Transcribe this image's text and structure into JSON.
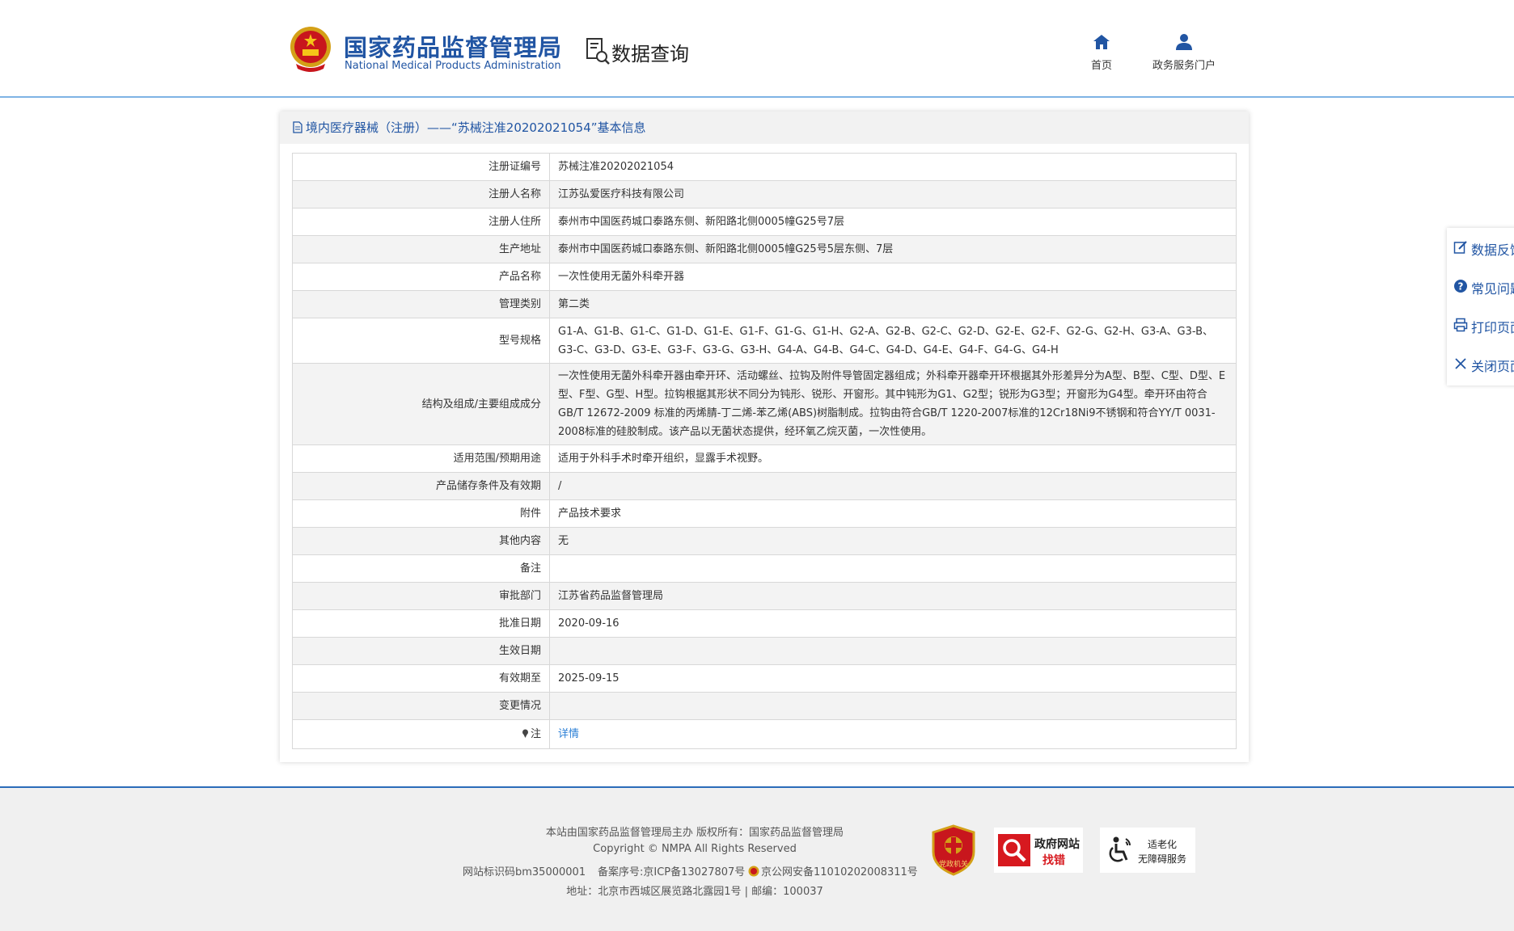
{
  "header": {
    "brand_cn": "国家药品监督管理局",
    "brand_en": "National Medical Products Administration",
    "query_label": "数据查询",
    "nav": [
      {
        "label": "首页",
        "icon": "home-icon"
      },
      {
        "label": "政务服务门户",
        "icon": "user-icon"
      }
    ]
  },
  "panel": {
    "title": "境内医疗器械（注册）——“苏械注准20202021054”基本信息",
    "rows": [
      {
        "label": "注册证编号",
        "value": "苏械注准20202021054"
      },
      {
        "label": "注册人名称",
        "value": "江苏弘爱医疗科技有限公司"
      },
      {
        "label": "注册人住所",
        "value": "泰州市中国医药城口泰路东侧、新阳路北侧0005幢G25号7层"
      },
      {
        "label": "生产地址",
        "value": "泰州市中国医药城口泰路东侧、新阳路北侧0005幢G25号5层东侧、7层"
      },
      {
        "label": "产品名称",
        "value": "一次性使用无菌外科牵开器"
      },
      {
        "label": "管理类别",
        "value": "第二类"
      },
      {
        "label": "型号规格",
        "value": "G1-A、G1-B、G1-C、G1-D、G1-E、G1-F、G1-G、G1-H、G2-A、G2-B、G2-C、G2-D、G2-E、G2-F、G2-G、G2-H、G3-A、G3-B、G3-C、G3-D、G3-E、G3-F、G3-G、G3-H、G4-A、G4-B、G4-C、G4-D、G4-E、G4-F、G4-G、G4-H"
      },
      {
        "label": "结构及组成/主要组成成分",
        "value": "一次性使用无菌外科牵开器由牵开环、活动螺丝、拉钩及附件导管固定器组成；外科牵开器牵开环根据其外形差异分为A型、B型、C型、D型、E型、F型、G型、H型。拉钩根据其形状不同分为钝形、锐形、开窗形。其中钝形为G1、G2型；锐形为G3型；开窗形为G4型。牵开环由符合GB/T 12672-2009 标准的丙烯腈-丁二烯-苯乙烯(ABS)树脂制成。拉钩由符合GB/T 1220-2007标准的12Cr18Ni9不锈钢和符合YY/T 0031-2008标准的硅胶制成。该产品以无菌状态提供，经环氧乙烷灭菌，一次性使用。"
      },
      {
        "label": "适用范围/预期用途",
        "value": "适用于外科手术时牵开组织，显露手术视野。"
      },
      {
        "label": "产品储存条件及有效期",
        "value": "/"
      },
      {
        "label": "附件",
        "value": "产品技术要求"
      },
      {
        "label": "其他内容",
        "value": "无"
      },
      {
        "label": "备注",
        "value": ""
      },
      {
        "label": "审批部门",
        "value": "江苏省药品监督管理局"
      },
      {
        "label": "批准日期",
        "value": "2020-09-16"
      },
      {
        "label": "生效日期",
        "value": ""
      },
      {
        "label": "有效期至",
        "value": "2025-09-15"
      },
      {
        "label": "变更情况",
        "value": ""
      }
    ],
    "note_label": "注",
    "note_link": "详情"
  },
  "side_toolbar": [
    {
      "label": "数据反馈",
      "icon": "edit-icon"
    },
    {
      "label": "常见问题",
      "icon": "question-icon"
    },
    {
      "label": "打印页面",
      "icon": "print-icon"
    },
    {
      "label": "关闭页面",
      "icon": "close-icon"
    }
  ],
  "footer": {
    "line1": "本站由国家药品监督管理局主办 版权所有：国家药品监督管理局",
    "line2": "Copyright © NMPA All Rights Reserved",
    "site_id": "网站标识码bm35000001",
    "icp": "备案序号:京ICP备13027807号",
    "police": "京公网安备11010202008311号",
    "address": "地址：北京市西城区展览路北露园1号 | 邮编：100037",
    "badge_party": "党政机关",
    "badge_error_1": "政府网站",
    "badge_error_2": "找错",
    "badge_access_1": "适老化",
    "badge_access_2": "无障碍服务"
  }
}
